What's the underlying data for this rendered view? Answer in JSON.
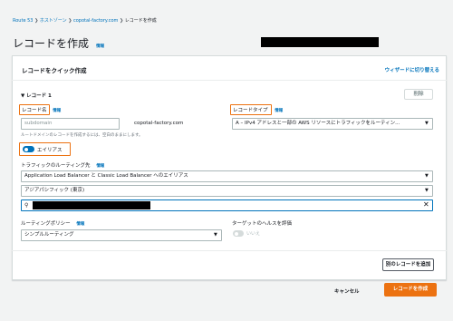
{
  "breadcrumb": [
    "Route 53",
    "ホストゾーン",
    "copotal-factory.com",
    "レコードを作成"
  ],
  "page_title": "レコードを作成",
  "info": "情報",
  "panel": {
    "title": "レコードをクイック作成",
    "wizard_link": "ウィザードに切り替える"
  },
  "record": {
    "heading": "▼ レコード 1",
    "delete_label": "削除",
    "name_label": "レコード名",
    "name_placeholder": "subdomain",
    "domain_suffix": "copotal-factory.com",
    "name_hint": "ルートドメインのレコードを作成するには、空白のままにします。",
    "type_label": "レコードタイプ",
    "type_value": "A – IPv4 アドレスと一部の AWS リソースにトラフィックをルーティン...",
    "alias_label": "エイリアス",
    "traffic_label": "トラフィックのルーティング先",
    "endpoint_value": "Application Load Balancer と Classic Load Balancer へのエイリアス",
    "region_value": "アジアパシフィック (東京)",
    "search_placeholder": "",
    "routing_label": "ルーティングポリシー",
    "routing_value": "シンプルルーティング",
    "health_label": "ターゲットのヘルスを評価",
    "health_toggle": "いいえ"
  },
  "add_record_label": "別のレコードを追加",
  "cancel_label": "キャンセル",
  "create_label": "レコードを作成",
  "colors": {
    "accent": "#ec7211",
    "link": "#0073bb",
    "toggle_on": "#0073bb"
  }
}
